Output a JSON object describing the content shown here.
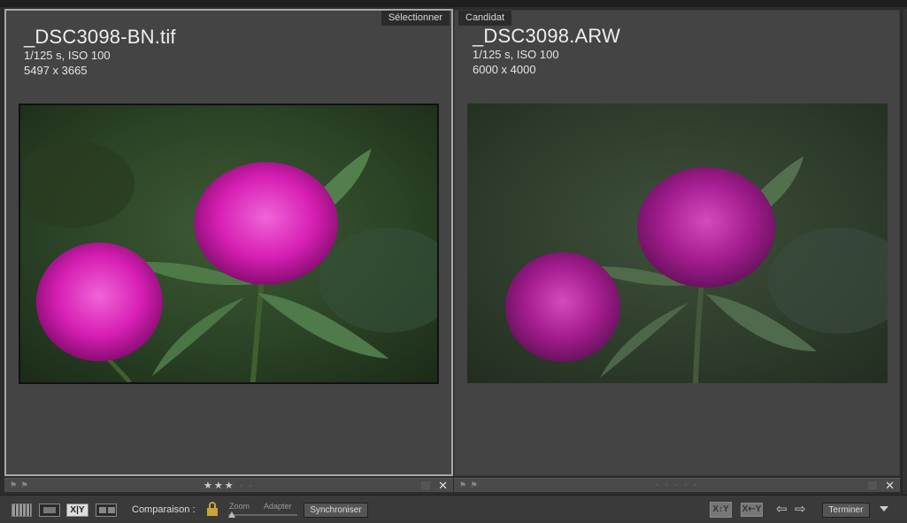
{
  "left_panel": {
    "tag": "Sélectionner",
    "filename": "_DSC3098-BN.tif",
    "exposure": "1/125 s, ISO 100",
    "dimensions": "5497 x 3665",
    "rating_stars": 3,
    "rating_filled": "★★★",
    "rating_empty": "· ·"
  },
  "right_panel": {
    "tag": "Candidat",
    "filename": "_DSC3098.ARW",
    "exposure": "1/125 s, ISO 100",
    "dimensions": "6000 x 4000",
    "rating_stars": 0,
    "rating_empty": "· · · · ·"
  },
  "footer": {
    "close_glyph": "✕",
    "flag_glyph": "⚑ ⚑"
  },
  "toolbar": {
    "xy_label": "X|Y",
    "comparison_label": "Comparaison :",
    "zoom_label": "Zoom",
    "adapter_label": "Adapter",
    "sync_label": "Synchroniser",
    "swap_label": "X↕Y",
    "promote_label": "X⇠Y",
    "prev_arrow": "⇦",
    "next_arrow": "⇨",
    "done_label": "Terminer"
  },
  "colors": {
    "panel_bg": "#444444",
    "selected_border": "#a8a8a8",
    "flower_magenta": "#c81ea8",
    "lock_gold": "#c9a43a"
  }
}
